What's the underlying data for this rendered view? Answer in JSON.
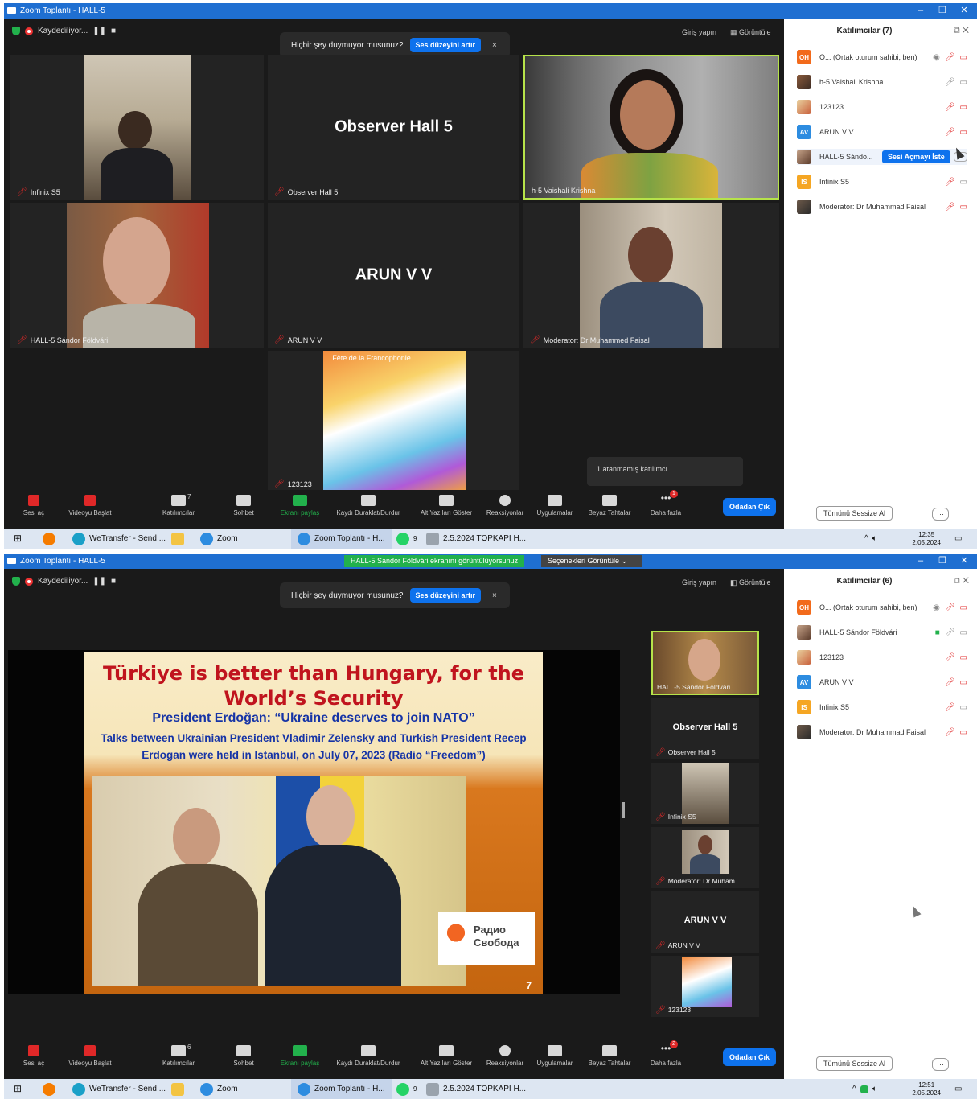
{
  "screens": [
    {
      "window_title": "Zoom Toplantı - HALL-5",
      "recording_label": "Kaydediliyor...",
      "sign_in": "Giriş yapın",
      "view_label": "Görüntüle",
      "notice": {
        "text": "Hiçbir şey duymuyor musunuz?",
        "button": "Ses düzeyini artır",
        "close": "×"
      },
      "tiles": [
        {
          "name": "Infinix S5"
        },
        {
          "name": "Observer Hall 5",
          "big": "Observer Hall 5"
        },
        {
          "name": "h-5 Vaishali Krishna"
        },
        {
          "name": "HALL-5 Sándor Földvári"
        },
        {
          "name": "ARUN V V",
          "big": "ARUN V V"
        },
        {
          "name": "Moderator: Dr Muhammed Faisal"
        },
        {
          "name": "123123",
          "poster": "Fête de la Francophonie"
        }
      ],
      "unassigned": "1 atanmamış katılımcı",
      "controls": [
        "Sesi aç",
        "Videoyu Başlat",
        "Katılımcılar",
        "Sohbet",
        "Ekranı paylaş",
        "Kaydı Duraklat/Durdur",
        "Alt Yazıları Göster",
        "Reaksiyonlar",
        "Uygulamalar",
        "Beyaz Tahtalar",
        "Daha fazla"
      ],
      "participant_count": "7",
      "more_badge": "1",
      "leave": "Odadan Çık",
      "panel": {
        "title": "Katılımcılar (7)",
        "participants": [
          {
            "initials": "OH",
            "name": "O... (Ortak oturum sahibi, ben)",
            "color": "#f26a1b"
          },
          {
            "initials": "",
            "name": "h-5 Vaishali Krishna",
            "color": ""
          },
          {
            "initials": "",
            "name": "123123",
            "color": ""
          },
          {
            "initials": "AV",
            "name": "ARUN V V",
            "color": "#2d8ce0"
          },
          {
            "initials": "",
            "name": "HALL-5 Sándo...",
            "color": "",
            "action": "Sesi Açmayı İste"
          },
          {
            "initials": "IS",
            "name": "Infinix S5",
            "color": "#f5a623"
          },
          {
            "initials": "",
            "name": "Moderator: Dr Muhammad Faisal",
            "color": ""
          }
        ],
        "mute_all": "Tümünü Sessize Al",
        "more": "···"
      },
      "taskbar": {
        "items": [
          "WeTransfer - Send ...",
          "Zoom",
          "Zoom Toplantı - H...",
          "2.5.2024 TOPKAPI H..."
        ],
        "whatsapp_badge": "9",
        "time": "12:35",
        "date": "2.05.2024"
      }
    },
    {
      "window_title": "Zoom Toplantı - HALL-5",
      "share_banner": "HALL-5 Sándor Földvári ekranını görüntülüyorsunuz",
      "options_label": "Seçenekleri Görüntüle",
      "recording_label": "Kaydediliyor...",
      "sign_in": "Giriş yapın",
      "view_label": "Görüntüle",
      "notice": {
        "text": "Hiçbir şey duymuyor musunuz?",
        "button": "Ses düzeyini artır",
        "close": "×"
      },
      "slide": {
        "title": "Türkiye is better than Hungary, for the World’s Security",
        "subtitle": "President Erdoğan: “Ukraine deserves to join NATO”",
        "body": "Talks between Ukrainian President Vladimir Zelensky and Turkish President Recep Erdogan were held in Istanbul, on July 07, 2023 (Radio “Freedom”)",
        "logo_text": "Радио Свобода",
        "page": "7"
      },
      "strip": [
        {
          "name": "HALL-5 Sándor Földvári"
        },
        {
          "name": "Observer Hall 5",
          "big": "Observer Hall 5"
        },
        {
          "name": "Infinix S5"
        },
        {
          "name": "Moderator: Dr Muham..."
        },
        {
          "name": "ARUN V V",
          "big": "ARUN V V"
        },
        {
          "name": "123123"
        }
      ],
      "controls": [
        "Sesi aç",
        "Videoyu Başlat",
        "Katılımcılar",
        "Sohbet",
        "Ekranı paylaş",
        "Kaydı Duraklat/Durdur",
        "Alt Yazıları Göster",
        "Reaksiyonlar",
        "Uygulamalar",
        "Beyaz Tahtalar",
        "Daha fazla"
      ],
      "participant_count": "6",
      "more_badge": "2",
      "leave": "Odadan Çık",
      "panel": {
        "title": "Katılımcılar (6)",
        "participants": [
          {
            "initials": "OH",
            "name": "O... (Ortak oturum sahibi, ben)",
            "color": "#f26a1b"
          },
          {
            "initials": "",
            "name": "HALL-5 Sándor Földvári",
            "color": ""
          },
          {
            "initials": "",
            "name": "123123",
            "color": ""
          },
          {
            "initials": "AV",
            "name": "ARUN V V",
            "color": "#2d8ce0"
          },
          {
            "initials": "IS",
            "name": "Infinix S5",
            "color": "#f5a623"
          },
          {
            "initials": "",
            "name": "Moderator: Dr Muhammad Faisal",
            "color": ""
          }
        ],
        "mute_all": "Tümünü Sessize Al",
        "more": "···"
      },
      "taskbar": {
        "items": [
          "WeTransfer - Send ...",
          "Zoom",
          "Zoom Toplantı - H...",
          "2.5.2024 TOPKAPI H..."
        ],
        "whatsapp_badge": "9",
        "time": "12:51",
        "date": "2.05.2024"
      }
    }
  ],
  "colors": {
    "accent": "#0e72ed",
    "titlebar": "#1f6fd1",
    "muted": "#e02828",
    "share": "#22b14c"
  }
}
